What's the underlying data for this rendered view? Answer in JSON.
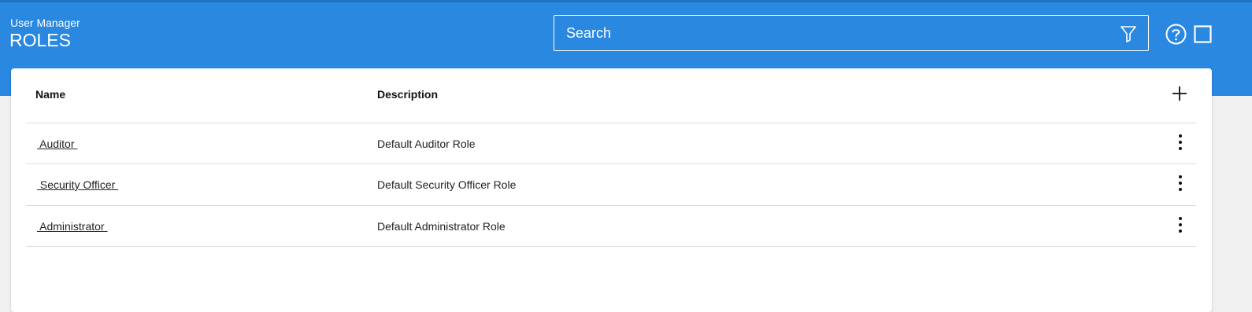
{
  "header": {
    "app_name": "User Manager",
    "title": "ROLES",
    "search_placeholder": "Search",
    "background": "#2a88e0"
  },
  "icons": {
    "filter": "filter-icon",
    "help": "help-circle-icon",
    "window": "square-window-icon",
    "add": "plus-icon",
    "more": "more-vertical-icon"
  },
  "table": {
    "columns": [
      "Name",
      "Description"
    ],
    "rows": [
      {
        "name": " Auditor ",
        "description": "Default Auditor Role"
      },
      {
        "name": " Security Officer ",
        "description": "Default Security Officer Role"
      },
      {
        "name": " Administrator ",
        "description": "Default Administrator Role"
      }
    ]
  }
}
